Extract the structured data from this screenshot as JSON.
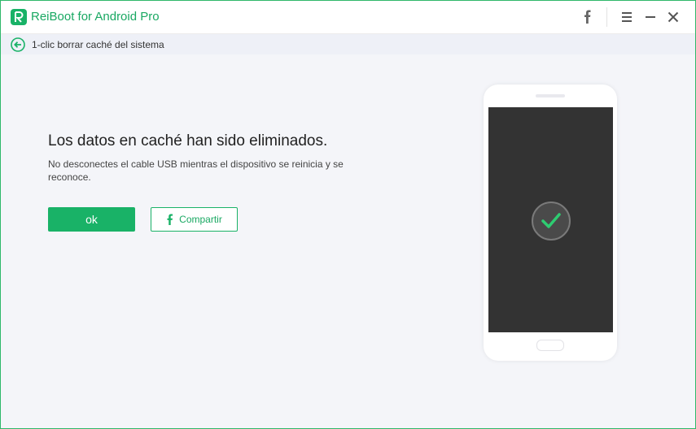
{
  "app": {
    "title": "ReiBoot for Android Pro",
    "logo_letter": "R",
    "brand_color": "#19b267"
  },
  "titlebar": {
    "icons": [
      "facebook-icon",
      "menu-icon",
      "minimize-icon",
      "close-icon"
    ]
  },
  "breadcrumb": {
    "label": "1-clic borrar caché del sistema"
  },
  "result": {
    "title": "Los datos en caché han sido eliminados.",
    "description": "No desconectes el cable USB mientras el dispositivo se reinicia y se reconoce."
  },
  "actions": {
    "ok_label": "ok",
    "share_label": "Compartir"
  },
  "phone": {
    "status_icon": "checkmark-icon",
    "check_color": "#2ecc71"
  }
}
